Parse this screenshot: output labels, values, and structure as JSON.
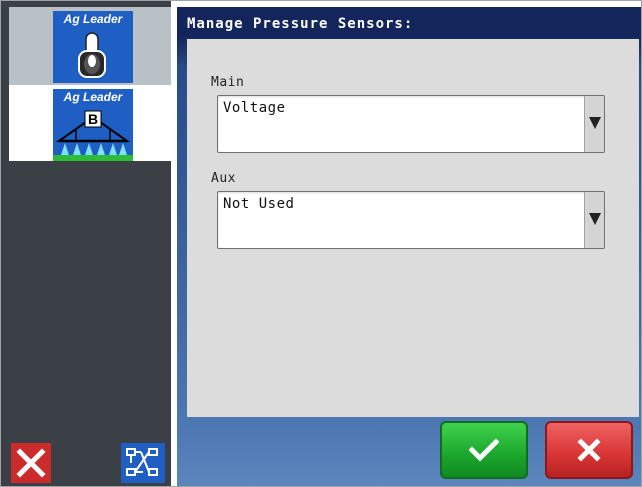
{
  "sidebar": {
    "modules": [
      {
        "brand": "Ag Leader",
        "icon": "toggle-switch-icon"
      },
      {
        "brand": "Ag Leader",
        "icon": "boom-sprayer-icon",
        "badge": "B"
      }
    ],
    "buttons": {
      "cancel_icon": "close-icon",
      "diagnostics_icon": "network-diagram-icon"
    }
  },
  "dialog": {
    "title": "Manage Pressure Sensors:",
    "fields": [
      {
        "label": "Main",
        "value": "Voltage"
      },
      {
        "label": "Aux",
        "value": "Not Used"
      }
    ],
    "ok_icon": "checkmark-icon",
    "cancel_icon": "close-icon"
  },
  "colors": {
    "brand_blue": "#1f5fc4",
    "title_bar": "#13255a",
    "ok_green": "#1aa62c",
    "cancel_red": "#d83434",
    "sidebar_dark": "#3a4046",
    "spray_green": "#2dbb3a"
  }
}
